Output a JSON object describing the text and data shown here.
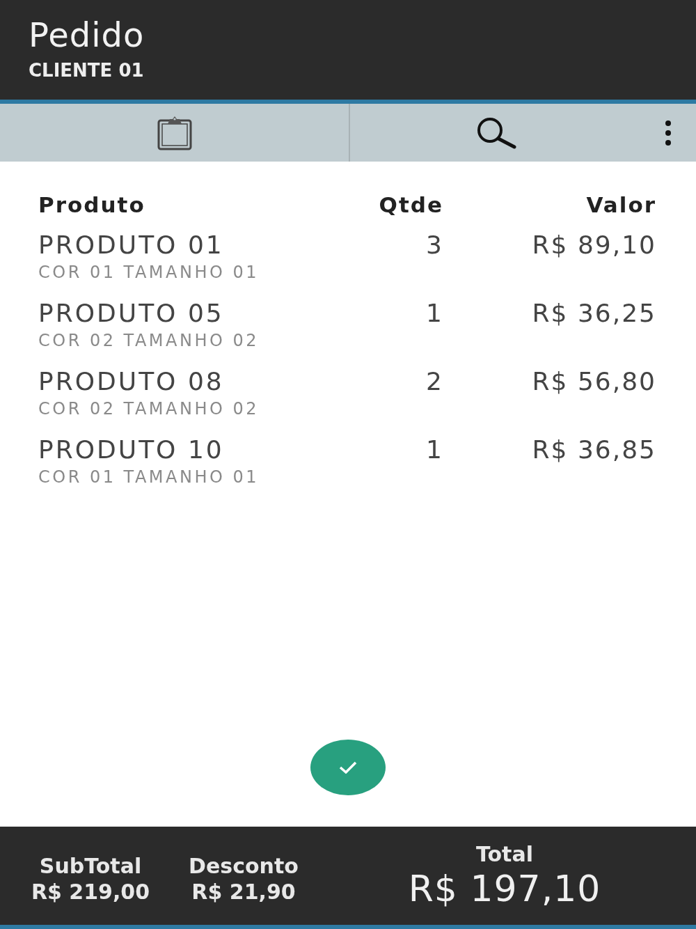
{
  "header": {
    "title": "Pedido",
    "subtitle": "CLIENTE 01"
  },
  "table": {
    "columns": [
      "Produto",
      "Qtde",
      "Valor"
    ],
    "rows": [
      {
        "product": "PRODUTO 01",
        "variant": "COR 01 TAMANHO 01",
        "qty": "3",
        "value": "R$ 89,10"
      },
      {
        "product": "PRODUTO 05",
        "variant": "COR 02 TAMANHO 02",
        "qty": "1",
        "value": "R$ 36,25"
      },
      {
        "product": "PRODUTO 08",
        "variant": "COR 02 TAMANHO 02",
        "qty": "2",
        "value": "R$ 56,80"
      },
      {
        "product": "PRODUTO 10",
        "variant": "COR 01 TAMANHO 01",
        "qty": "1",
        "value": "R$ 36,85"
      }
    ]
  },
  "summary": [
    {
      "label": "SubTotal",
      "value": "R$ 219,00"
    },
    {
      "label": "Desconto",
      "value": "R$ 21,90"
    }
  ],
  "total": {
    "label": "Total",
    "value": "R$ 197,10"
  }
}
